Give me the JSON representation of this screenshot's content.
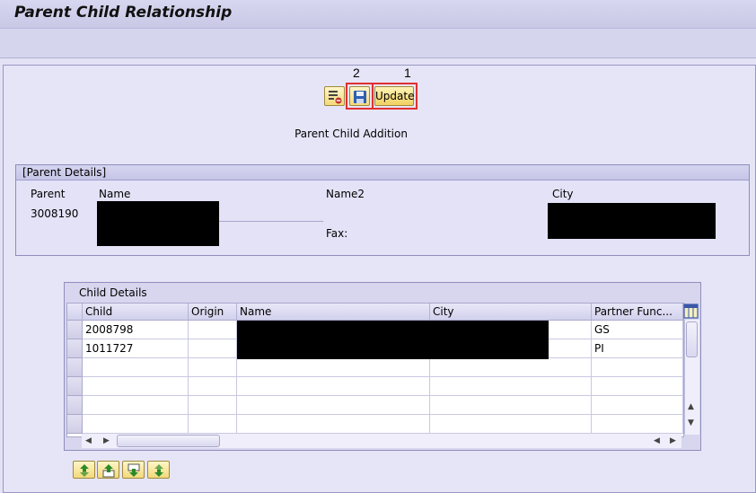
{
  "header": {
    "title": "Parent Child Relationship"
  },
  "toolbar": {
    "annotation_2": "2",
    "annotation_1": "1",
    "update_label": "Update",
    "icons": [
      "list-delete-icon",
      "save-icon"
    ]
  },
  "section": {
    "title": "Parent Child Addition"
  },
  "parent_details": {
    "group_title": "[Parent Details]",
    "parent_label": "Parent",
    "parent_value": "3008190",
    "name_label": "Name",
    "name2_label": "Name2",
    "fax_label": "Fax:",
    "city_label": "City"
  },
  "child_details": {
    "panel_title": "Child Details",
    "columns": [
      "Child",
      "Origin",
      "Name",
      "City",
      "Partner Func..."
    ],
    "rows": [
      {
        "child": "2008798",
        "origin": "",
        "partner_function": "GS"
      },
      {
        "child": "1011727",
        "origin": "",
        "partner_function": "PI"
      }
    ]
  },
  "bottom_buttons": [
    "move-top-icon",
    "move-up-icon",
    "move-down-icon",
    "move-bottom-icon"
  ],
  "colors": {
    "accent_red": "#e03030",
    "button_yellow": "#f3d97a",
    "background": "#e3e2f5"
  }
}
